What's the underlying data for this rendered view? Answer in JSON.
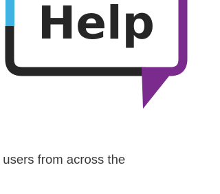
{
  "graphic": {
    "logo_text": "Help",
    "colors": {
      "bubble_outline": "#262626",
      "accent_left": "#41b3e3",
      "accent_tail": "#7b2b8e",
      "text": "#262626"
    }
  },
  "caption": {
    "text": "t users from across the"
  }
}
